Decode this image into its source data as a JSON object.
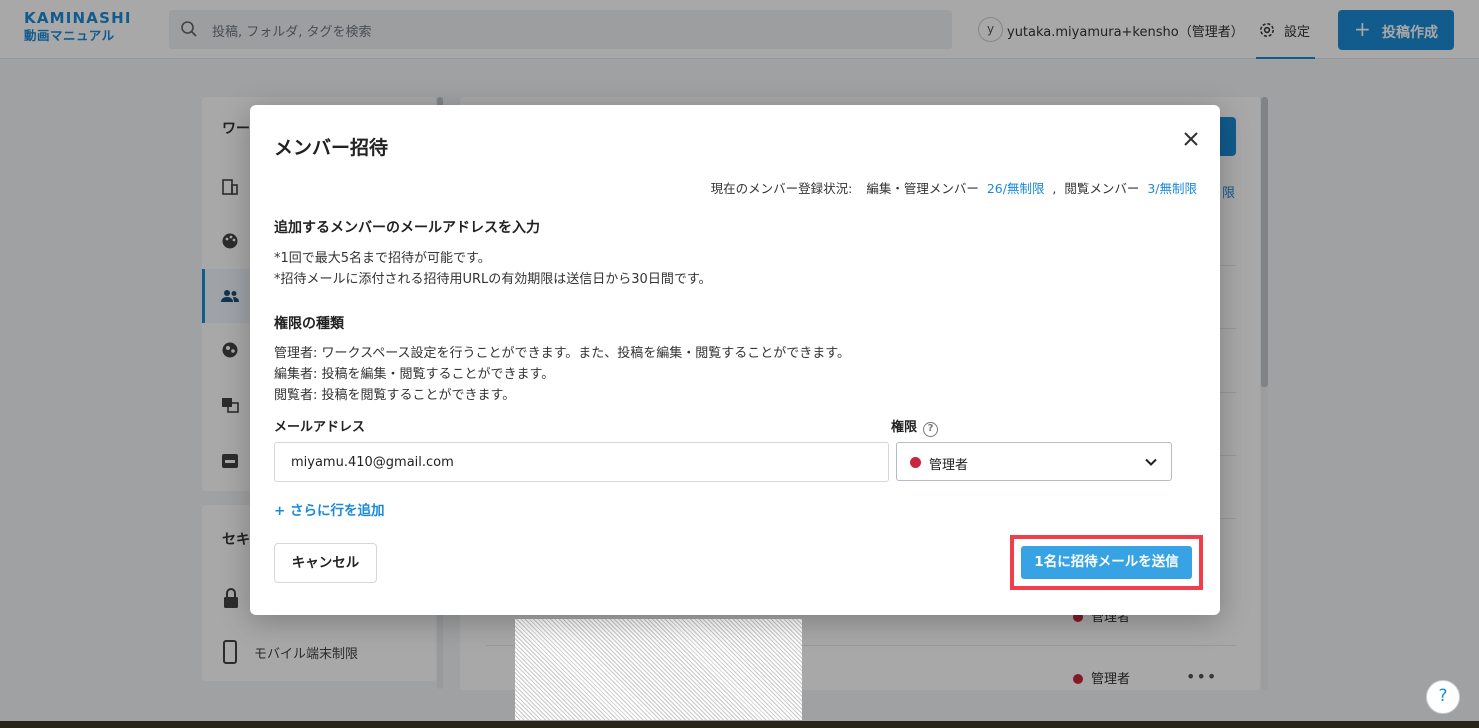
{
  "header": {
    "logo_line1": "KAMINASHI",
    "logo_line2": "動画マニュアル",
    "search_placeholder": "投稿, フォルダ, タグを検索",
    "avatar_initial": "y",
    "user_name": "yutaka.miyamura+kensho（管理者）",
    "settings_label": "設定",
    "create_label": "投稿作成"
  },
  "sidebar": {
    "section1_title": "ワー",
    "section2_title": "セキ",
    "mobile_label": "モバイル端末制限"
  },
  "background_rows": {
    "role_label": "管理者",
    "link_fragment": "限"
  },
  "modal": {
    "title": "メンバー招待",
    "status_label": "現在のメンバー登録状況:",
    "editor_label": "編集・管理メンバー",
    "editor_count": "26/無制限",
    "separator": ",",
    "viewer_label": "閲覧メンバー",
    "viewer_count": "3/無制限",
    "email_heading": "追加するメンバーのメールアドレスを入力",
    "note1": "*1回で最大5名まで招待が可能です。",
    "note2": "*招待メールに添付される招待用URLの有効期限は送信日から30日間です。",
    "role_heading": "権限の種類",
    "role_admin_desc": "管理者: ワークスペース設定を行うことができます。また、投稿を編集・閲覧することができます。",
    "role_editor_desc": "編集者: 投稿を編集・閲覧することができます。",
    "role_viewer_desc": "閲覧者: 投稿を閲覧することができます。",
    "email_label": "メールアドレス",
    "role_label": "権限",
    "email_value": "miyamu.410@gmail.com",
    "role_value": "管理者",
    "add_row_label": "+ さらに行を追加",
    "cancel_label": "キャンセル",
    "send_label": "1名に招待メールを送信"
  },
  "help_label": "?",
  "colors": {
    "accent": "#1a8ad6",
    "send_button": "#37a3e4",
    "highlight": "#f03e4a",
    "admin_dot": "#c8263e"
  }
}
